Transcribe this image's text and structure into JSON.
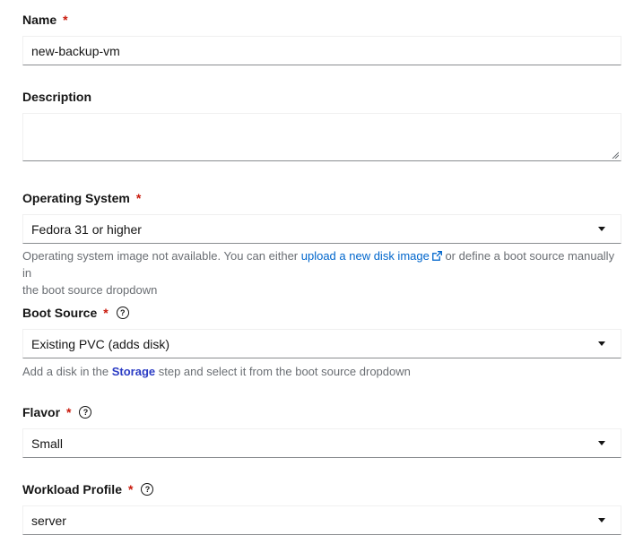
{
  "name": {
    "label": "Name",
    "required_mark": "*",
    "value": "new-backup-vm"
  },
  "description": {
    "label": "Description",
    "value": ""
  },
  "operating_system": {
    "label": "Operating System",
    "required_mark": "*",
    "selected": "Fedora 31 or higher",
    "helper_before": "Operating system image not available. You can either ",
    "helper_link": "upload a new disk image",
    "helper_after_line1": " or define a boot source manually in",
    "helper_line2": "the boot source dropdown"
  },
  "boot_source": {
    "label": "Boot Source",
    "required_mark": "*",
    "selected": "Existing PVC (adds disk)",
    "helper_before": "Add a disk in the ",
    "helper_link": "Storage",
    "helper_after": " step and select it from the boot source dropdown"
  },
  "flavor": {
    "label": "Flavor",
    "required_mark": "*",
    "selected": "Small"
  },
  "workload_profile": {
    "label": "Workload Profile",
    "required_mark": "*",
    "selected": "server"
  },
  "icons": {
    "help": "?",
    "dropdown": "caret-down-icon",
    "external_link": "external-link-icon"
  },
  "colors": {
    "required": "#c9190b",
    "link": "#0066cc",
    "helper_text": "#6a6e73"
  }
}
